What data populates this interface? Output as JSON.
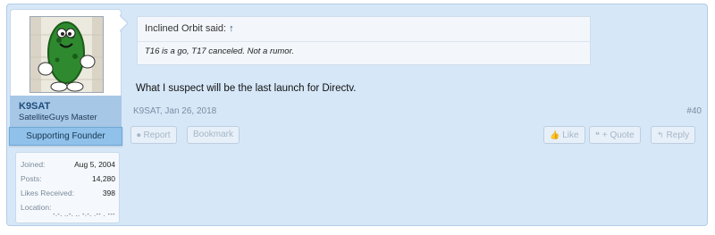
{
  "post": {
    "author": {
      "username": "K9SAT",
      "title": "SatelliteGuys Master",
      "banner": "Supporting Founder",
      "stats": [
        {
          "label": "Joined:",
          "value": "Aug 5, 2004"
        },
        {
          "label": "Posts:",
          "value": "14,280"
        },
        {
          "label": "Likes Received:",
          "value": "398"
        },
        {
          "label": "Location:",
          "value": ""
        }
      ],
      "location_value": "-.-. ..-. .. -.-. .-- . ---"
    },
    "quote": {
      "header": "Inclined Orbit said:",
      "arrow": "↑",
      "body": "T16 is a go, T17 canceled. Not a rumor."
    },
    "message": "What I suspect will be the last launch for Directv.",
    "meta": {
      "author_date": "K9SAT, Jan 26, 2018",
      "post_number": "#40"
    },
    "actions": {
      "report": "Report",
      "bookmark": "Bookmark",
      "like": "Like",
      "quote": "+ Quote",
      "reply": "Reply"
    }
  }
}
